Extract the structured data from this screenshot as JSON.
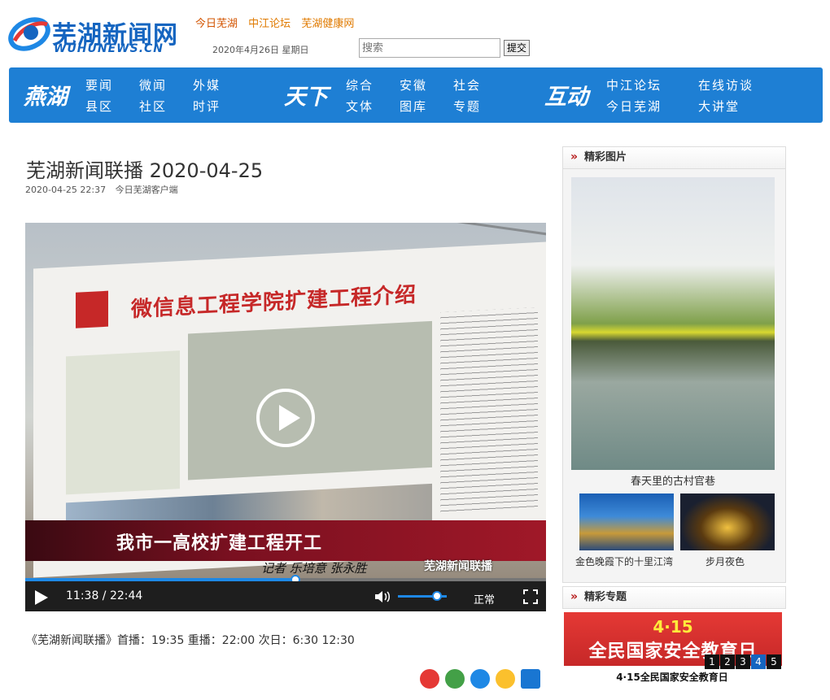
{
  "site": {
    "name_cn": "芜湖新闻网",
    "name_en": "WUHUNEWS.CN",
    "top_links": [
      "今日芜湖",
      "中江论坛",
      "芜湖健康网"
    ],
    "date": "2020年4月26日 星期日",
    "search_placeholder": "搜索",
    "search_button": "提交"
  },
  "nav": {
    "sections": [
      {
        "title": "燕湖",
        "items": [
          "要闻",
          "微闻",
          "外媒",
          "县区",
          "社区",
          "时评"
        ]
      },
      {
        "title": "天下",
        "items": [
          "综合",
          "安徽",
          "社会",
          "文体",
          "图库",
          "专题"
        ]
      },
      {
        "title": "互动",
        "items": [
          "中江论坛",
          "在线访谈",
          "今日芜湖",
          "大讲堂"
        ]
      }
    ]
  },
  "article": {
    "title": "芜湖新闻联播 2020-04-25",
    "datetime": "2020-04-25 22:37",
    "source": "今日芜湖客户端",
    "schedule": "《芜湖新闻联播》首播：19:35 重播：22:00 次日：6:30 12:30"
  },
  "video": {
    "board_title": "微信息工程学院扩建工程介绍",
    "caption": "我市一高校扩建工程开工",
    "reporter": "记者  乐培意  张永胜",
    "brand": "芜湖新闻联播",
    "current_time": "11:38",
    "duration": "22:44",
    "time_display": "11:38 / 22:44",
    "progress_fraction": 0.518,
    "volume_fraction": 0.8,
    "speed": "正常"
  },
  "sidebar": {
    "pictures": {
      "heading": "精彩图片",
      "main_caption": "春天里的古村官巷",
      "thumbs": [
        {
          "caption": "金色晚霞下的十里江湾"
        },
        {
          "caption": "步月夜色"
        }
      ]
    },
    "topics": {
      "heading": "精彩专题",
      "banner_date": "4·15",
      "banner_title": "全民国家安全教育日",
      "pages": [
        "1",
        "2",
        "3",
        "4",
        "5"
      ],
      "active_page": "4",
      "caption": "4·15全民国家安全教育日"
    }
  },
  "colors": {
    "brand_blue": "#1565c0",
    "nav_blue": "#1e7fd4",
    "accent_orange": "#e07a00",
    "caption_red": "#a01828",
    "player_progress": "#1e88e5"
  },
  "icons": [
    "play-icon",
    "volume-icon",
    "fullscreen-icon",
    "weibo-icon",
    "wechat-icon",
    "qq-icon",
    "qzone-icon",
    "more-share-icon"
  ]
}
